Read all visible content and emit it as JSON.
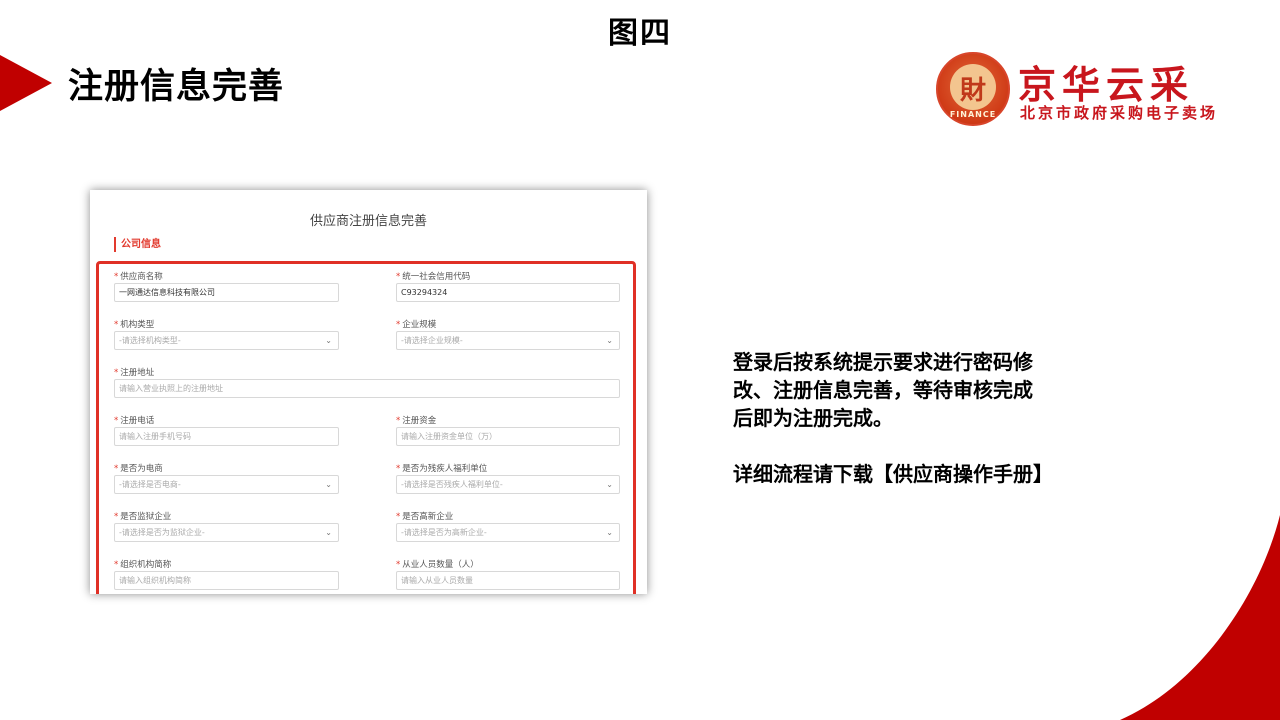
{
  "figure_title": "图四",
  "heading": "注册信息完善",
  "logo": {
    "main": "京华云采",
    "subtitle": "北京市政府采购电子卖场",
    "seal_char": "財",
    "seal_text": "FINANCE"
  },
  "description": {
    "lines": [
      "登录后按系统提示要求进行密码修",
      "改、注册信息完善，等待审核完成",
      "后即为注册完成。"
    ],
    "download": "详细流程请下载【供应商操作手册】"
  },
  "form": {
    "title": "供应商注册信息完善",
    "section": "公司信息",
    "fields": [
      {
        "label": "供应商名称",
        "value": "一网通达信息科技有限公司"
      },
      {
        "label": "统一社会信用代码",
        "value": "C93294324"
      },
      {
        "label": "机构类型",
        "placeholder": "-请选择机构类型-"
      },
      {
        "label": "企业规模",
        "placeholder": "-请选择企业规模-"
      },
      {
        "label": "注册地址",
        "placeholder": "请输入营业执照上的注册地址"
      },
      {
        "label": "注册电话",
        "placeholder": "请输入注册手机号码"
      },
      {
        "label": "注册资金",
        "placeholder": "请输入注册资金单位（万）"
      },
      {
        "label": "是否为电商",
        "placeholder": "-请选择是否电商-"
      },
      {
        "label": "是否为残疾人福利单位",
        "placeholder": "-请选择是否残疾人福利单位-"
      },
      {
        "label": "是否监狱企业",
        "placeholder": "-请选择是否为监狱企业-"
      },
      {
        "label": "是否高新企业",
        "placeholder": "-请选择是否为高新企业-"
      },
      {
        "label": "组织机构简称",
        "placeholder": "请输入组织机构简称"
      },
      {
        "label": "从业人员数量（人）",
        "placeholder": "请输入从业人员数量"
      }
    ]
  },
  "colors": {
    "accent": "#c00000",
    "form_border": "#e03026",
    "logo": "#c8161d"
  },
  "icons": {
    "select_caret": "chevron-down-icon",
    "required": "asterisk"
  }
}
